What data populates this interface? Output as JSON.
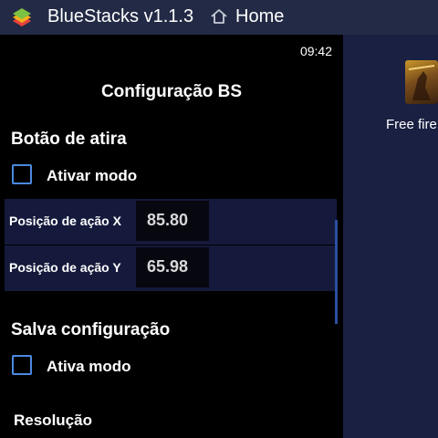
{
  "titlebar": {
    "app_title": "BlueStacks v1.1.3",
    "home_label": "Home"
  },
  "desktop": {
    "game_label": "Free fire"
  },
  "panel": {
    "clock": "09:42",
    "title": "Configuração BS",
    "shoot_section": {
      "title": "Botão de atira",
      "checkbox_label": "Ativar modo",
      "checked": false
    },
    "positions": [
      {
        "label": "Posição de ação X",
        "value": "85.80"
      },
      {
        "label": "Posição de ação Y",
        "value": "65.98"
      }
    ],
    "save_section": {
      "title": "Salva configuração",
      "checkbox_label": "Ativa modo",
      "checked": false
    },
    "resolution_title": "Resolução"
  },
  "colors": {
    "titlebar": "#232a45",
    "accent": "#4a8ae0",
    "row_bg": "#151a3c",
    "desktop": "#1a2042"
  }
}
